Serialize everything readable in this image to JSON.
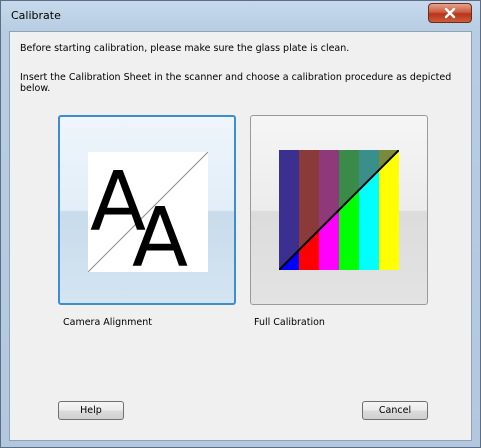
{
  "window": {
    "title": "Calibrate",
    "close_icon": "close-x-icon"
  },
  "messages": {
    "line1": "Before starting calibration, please make sure the glass plate is clean.",
    "line2": "Insert the Calibration Sheet in the scanner and choose a calibration procedure as depicted below."
  },
  "options": {
    "camera_alignment": {
      "label": "Camera Alignment",
      "glyph": "A",
      "selected": true,
      "icon": "camera-alignment-icon"
    },
    "full_calibration": {
      "label": "Full Calibration",
      "selected": false,
      "icon": "color-bars-icon",
      "colors_top": [
        "#3b2f8f",
        "#8b3a3a",
        "#8e3a7a",
        "#3a8a4a",
        "#3a8f8a",
        "#7a8a3a"
      ],
      "colors_bottom": [
        "#0000ff",
        "#ff0000",
        "#ff00ff",
        "#00ff00",
        "#00ffff",
        "#ffff00"
      ]
    }
  },
  "buttons": {
    "help": "Help",
    "cancel": "Cancel"
  },
  "colors": {
    "selection_border": "#3c8ed0",
    "client_background": "#f0f0f0",
    "close_button": "#c74a2c"
  }
}
